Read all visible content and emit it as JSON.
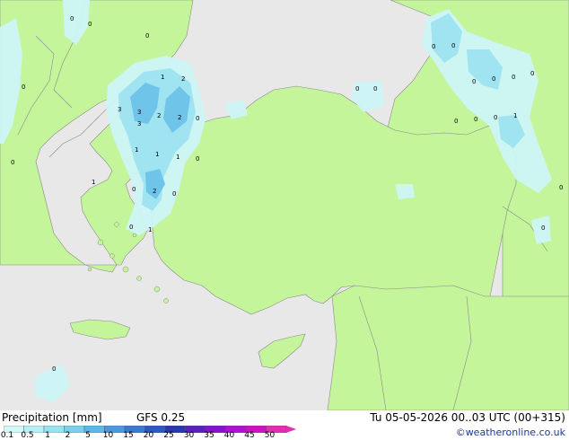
{
  "legend": {
    "title": "Precipitation [mm]",
    "model": "GFS 0.25",
    "datetime": "Tu 05-05-2026 00..03 UTC (00+315)",
    "credit": "©weatheronline.co.uk",
    "scale_labels": [
      "0.1",
      "0.5",
      "1",
      "2",
      "5",
      "10",
      "15",
      "20",
      "25",
      "30",
      "35",
      "40",
      "45",
      "50"
    ],
    "scale_colors": [
      "#d4f7f7",
      "#b4f0f4",
      "#96e4f0",
      "#78d2ee",
      "#5ab8ea",
      "#4a98e2",
      "#3a78d6",
      "#2a58c6",
      "#2838b0",
      "#5a20c0",
      "#8a10d0",
      "#b010d8",
      "#d010c8",
      "#e030b0"
    ]
  },
  "colors": {
    "sea": "#e8e8e8",
    "land": "#c4f59a",
    "border": "#8a8a8a",
    "precip_light": "#cdf4f6",
    "precip_mid": "#9fe4f0",
    "precip_heavy": "#6fc4ea"
  },
  "values": [
    "0",
    "0",
    "0",
    "0",
    "0",
    "1",
    "2",
    "3",
    "3",
    "2",
    "3",
    "2",
    "1",
    "1",
    "1",
    "0",
    "0",
    "2",
    "0",
    "0",
    "0",
    "1",
    "0",
    "0",
    "1",
    "0",
    "0",
    "0",
    "0",
    "0",
    "0",
    "0",
    "0",
    "1",
    "0",
    "0",
    "0",
    "0"
  ]
}
